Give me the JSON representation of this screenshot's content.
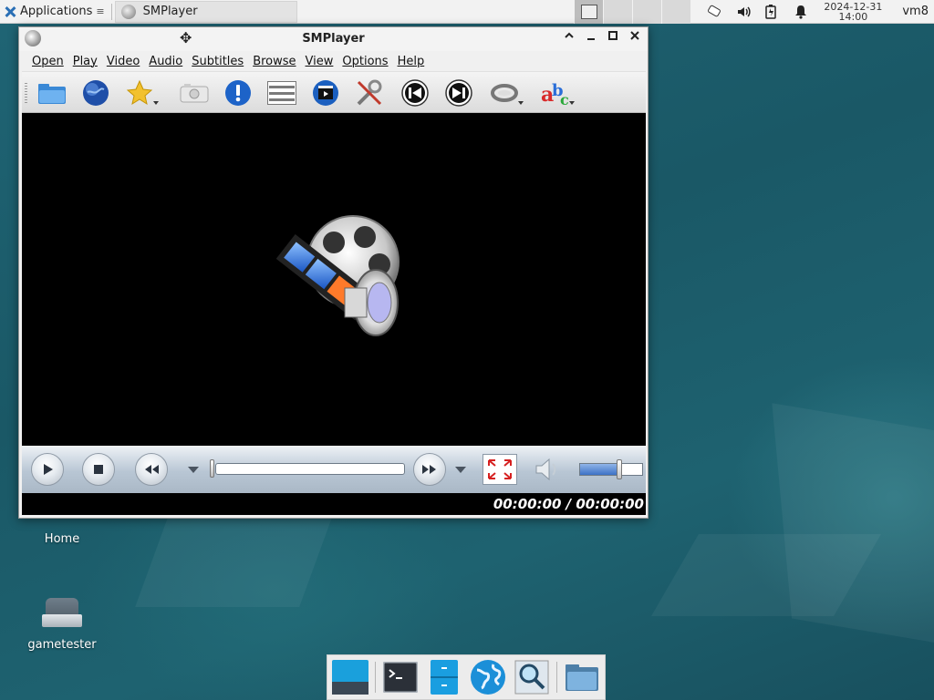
{
  "top_panel": {
    "applications_label": "Applications",
    "task_label": "SMPlayer",
    "clock_date": "2024-12-31",
    "clock_time": "14:00",
    "user": "vm8"
  },
  "window": {
    "title": "SMPlayer",
    "menu": [
      "Open",
      "Play",
      "Video",
      "Audio",
      "Subtitles",
      "Browse",
      "View",
      "Options",
      "Help"
    ],
    "toolbar_icons": [
      "open-folder-icon",
      "open-url-globe-icon",
      "favorites-star-icon",
      "screenshot-camera-icon",
      "info-icon",
      "playlist-icon",
      "video-clapper-icon",
      "preferences-tools-icon",
      "previous-icon",
      "next-icon",
      "audio-track-icon",
      "subtitles-abc-icon"
    ],
    "time_display": "00:00:00 / 00:00:00",
    "progress": 0,
    "volume": 0.65
  },
  "desktop": {
    "icons": [
      {
        "label": "Home"
      },
      {
        "label": "gametester"
      }
    ]
  },
  "dock": {
    "items": [
      "show-desktop-icon",
      "terminal-icon",
      "file-cabinet-icon",
      "web-browser-globe-icon",
      "app-finder-search-icon",
      "files-folder-icon"
    ]
  }
}
